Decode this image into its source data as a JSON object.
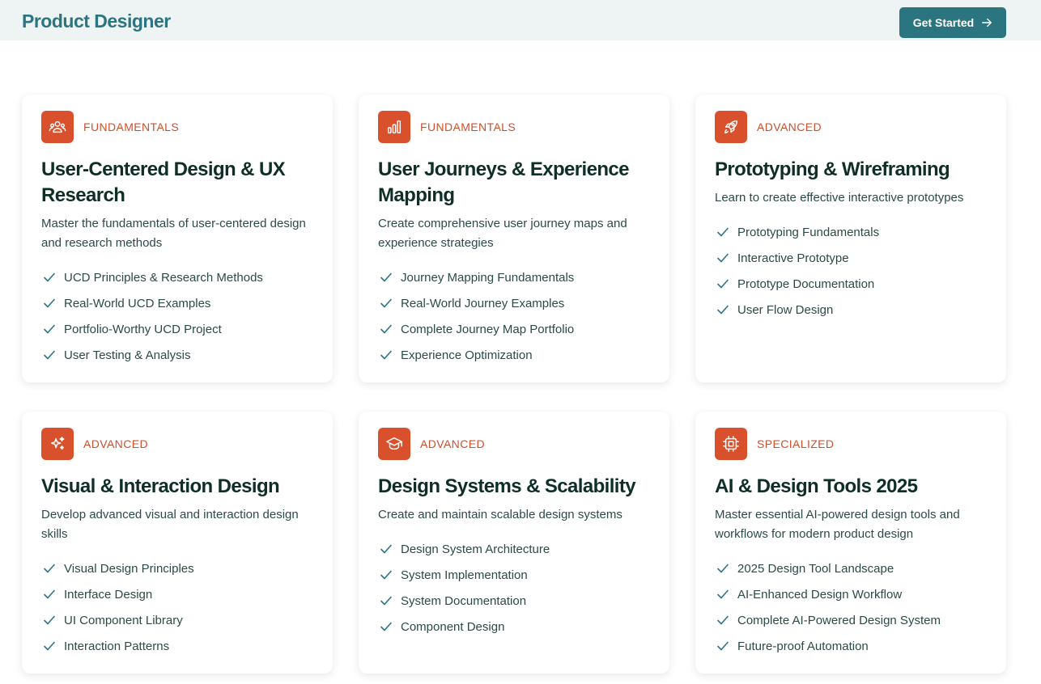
{
  "header": {
    "brand": "Product Designer",
    "cta_label": "Get Started"
  },
  "colors": {
    "brand": "#2b7580",
    "accent": "#d9512c",
    "heading": "#0f2e27"
  },
  "cards": [
    {
      "icon": "users-icon",
      "tag": "FUNDAMENTALS",
      "title": "User-Centered Design & UX Research",
      "description": "Master the fundamentals of user-centered design and research methods",
      "features": [
        "UCD Principles & Research Methods",
        "Real-World UCD Examples",
        "Portfolio-Worthy UCD Project",
        "User Testing & Analysis"
      ]
    },
    {
      "icon": "bar-chart-icon",
      "tag": "FUNDAMENTALS",
      "title": "User Journeys & Experience Mapping",
      "description": "Create comprehensive user journey maps and experience strategies",
      "features": [
        "Journey Mapping Fundamentals",
        "Real-World Journey Examples",
        "Complete Journey Map Portfolio",
        "Experience Optimization"
      ]
    },
    {
      "icon": "rocket-icon",
      "tag": "ADVANCED",
      "title": "Prototyping & Wireframing",
      "description": "Learn to create effective interactive prototypes",
      "features": [
        "Prototyping Fundamentals",
        "Interactive Prototype",
        "Prototype Documentation",
        "User Flow Design"
      ]
    },
    {
      "icon": "sparkles-icon",
      "tag": "ADVANCED",
      "title": "Visual & Interaction Design",
      "description": "Develop advanced visual and interaction design skills",
      "features": [
        "Visual Design Principles",
        "Interface Design",
        "UI Component Library",
        "Interaction Patterns"
      ]
    },
    {
      "icon": "graduation-cap-icon",
      "tag": "ADVANCED",
      "title": "Design Systems & Scalability",
      "description": "Create and maintain scalable design systems",
      "features": [
        "Design System Architecture",
        "System Implementation",
        "System Documentation",
        "Component Design"
      ]
    },
    {
      "icon": "cpu-icon",
      "tag": "SPECIALIZED",
      "title": "AI & Design Tools 2025",
      "description": "Master essential AI-powered design tools and workflows for modern product design",
      "features": [
        "2025 Design Tool Landscape",
        "AI-Enhanced Design Workflow",
        "Complete AI-Powered Design System",
        "Future-proof Automation"
      ]
    }
  ]
}
